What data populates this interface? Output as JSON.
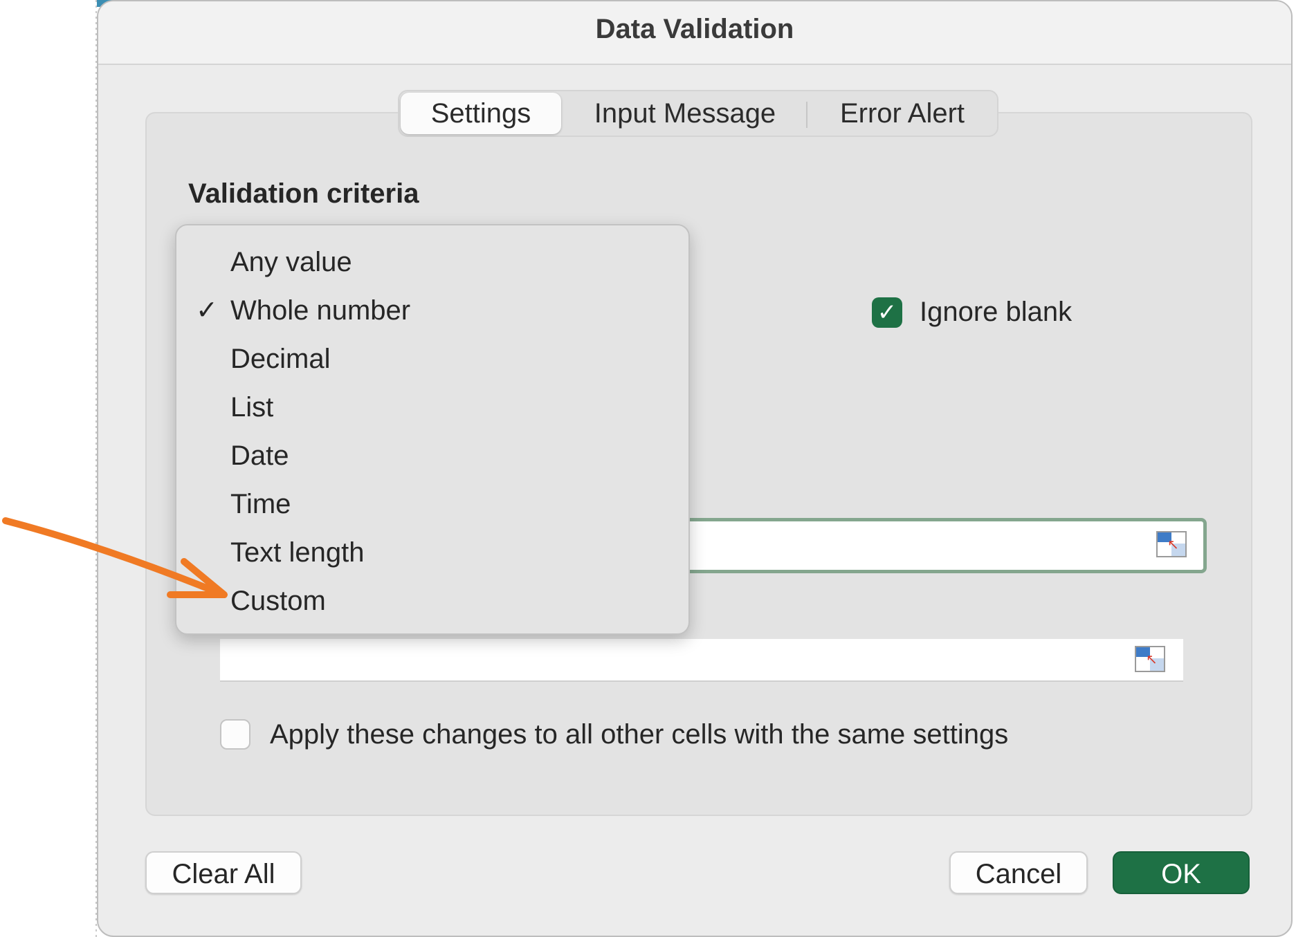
{
  "dialog": {
    "title": "Data Validation",
    "tabs": [
      {
        "label": "Settings",
        "selected": true
      },
      {
        "label": "Input Message",
        "selected": false
      },
      {
        "label": "Error Alert",
        "selected": false
      }
    ],
    "section_heading": "Validation criteria",
    "ignore_blank": {
      "label": "Ignore blank",
      "checked": true
    },
    "apply_all": {
      "label": "Apply these changes to all other cells with the same settings",
      "checked": false
    },
    "buttons": {
      "clear_all": "Clear All",
      "cancel": "Cancel",
      "ok": "OK"
    }
  },
  "allow_menu": {
    "selected": "Whole number",
    "options": [
      {
        "label": "Any value",
        "checked": false
      },
      {
        "label": "Whole number",
        "checked": true
      },
      {
        "label": "Decimal",
        "checked": false
      },
      {
        "label": "List",
        "checked": false
      },
      {
        "label": "Date",
        "checked": false
      },
      {
        "label": "Time",
        "checked": false
      },
      {
        "label": "Text length",
        "checked": false
      },
      {
        "label": "Custom",
        "checked": false
      }
    ],
    "check_glyph": "✓"
  },
  "annotation": {
    "color": "#f07a24",
    "points_to": "Custom"
  },
  "colors": {
    "accent_green": "#1e7145",
    "dialog_bg": "#ececec",
    "focus_border": "#84a68e"
  },
  "icons": [
    "stepper-icon",
    "range-selector-icon",
    "checkmark-icon",
    "arrow-annotation-icon"
  ]
}
